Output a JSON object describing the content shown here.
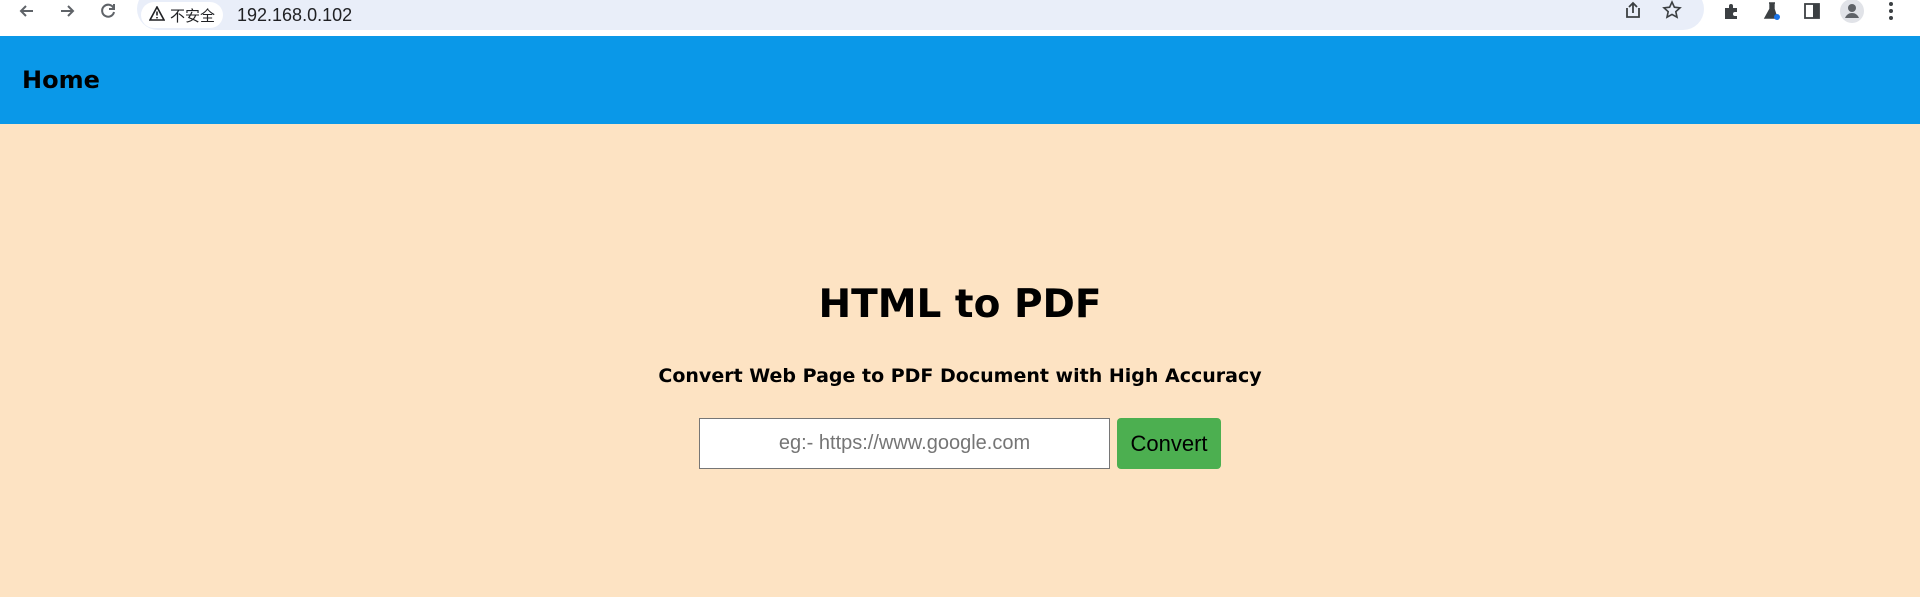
{
  "browser": {
    "security_label": "不安全",
    "url": "192.168.0.102",
    "icons": {
      "back": "back-arrow-icon",
      "forward": "forward-arrow-icon",
      "reload": "reload-icon",
      "warning": "warning-icon",
      "share": "share-icon",
      "bookmark": "star-icon",
      "extensions": "puzzle-icon",
      "lab": "flask-icon",
      "sidepanel": "side-panel-icon",
      "profile": "profile-icon",
      "menu": "kebab-menu-icon"
    }
  },
  "header": {
    "brand": "Home",
    "background": "#0a98e8"
  },
  "main": {
    "title": "HTML to PDF",
    "subtitle": "Convert Web Page to PDF Document with High Accuracy",
    "input": {
      "placeholder": "eg:- https://www.google.com",
      "value": ""
    },
    "convert_label": "Convert",
    "background": "#fde3c3",
    "button_color": "#4caf50"
  }
}
